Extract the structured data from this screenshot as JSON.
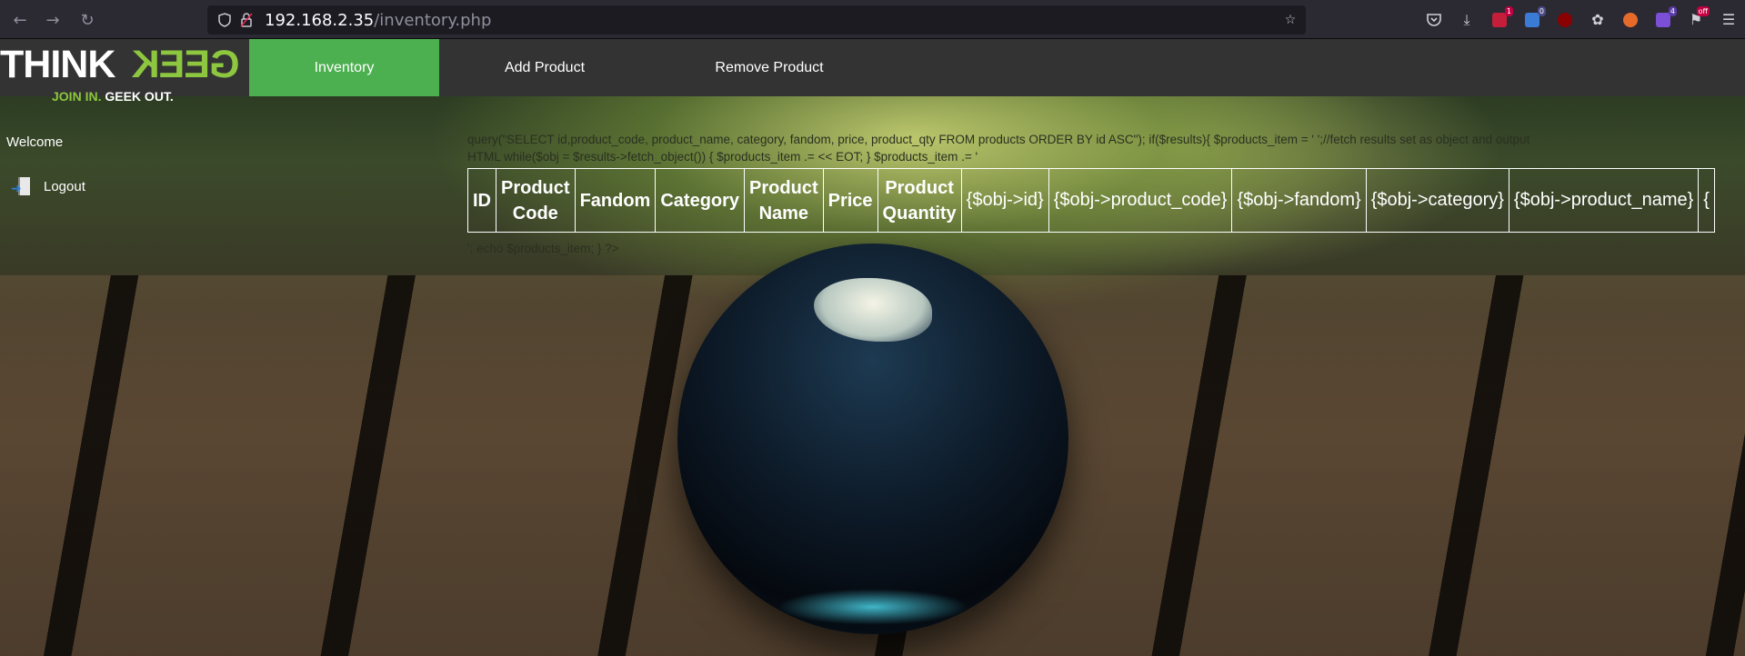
{
  "browser": {
    "url_host": "192.168.2.35",
    "url_path": "/inventory.php",
    "extension_badges": [
      "1",
      "0",
      "4",
      "off"
    ]
  },
  "nav": {
    "logo_think": "THINK",
    "logo_geek": "GEEK",
    "logo_tag_1": "JOIN IN.",
    "logo_tag_2": "GEEK OUT.",
    "items": [
      {
        "label": "Inventory"
      },
      {
        "label": "Add Product"
      },
      {
        "label": "Remove Product"
      }
    ]
  },
  "sidebar": {
    "welcome": "Welcome",
    "logout": "Logout"
  },
  "code_leak": {
    "line_top": "query(\"SELECT id,product_code, product_name, category, fandom, price, product_qty FROM products ORDER BY id ASC\"); if($results){ $products_item = ' ';//fetch results set as object and output HTML while($obj = $results->fetch_object()) { $products_item .= << EOT; } $products_item .= '",
    "line_bottom": "'; echo $products_item; } ?>"
  },
  "table": {
    "headers": [
      "ID",
      "Product Code",
      "Fandom",
      "Category",
      "Product Name",
      "Price",
      "Product Quantity"
    ],
    "cells": [
      "{$obj->id}",
      "{$obj->product_code}",
      "{$obj->fandom}",
      "{$obj->category}",
      "{$obj->product_name}",
      "{"
    ]
  },
  "colors": {
    "nav_bg": "#333333",
    "active_tab": "#4caf50",
    "logo_green": "#8dc63f"
  }
}
